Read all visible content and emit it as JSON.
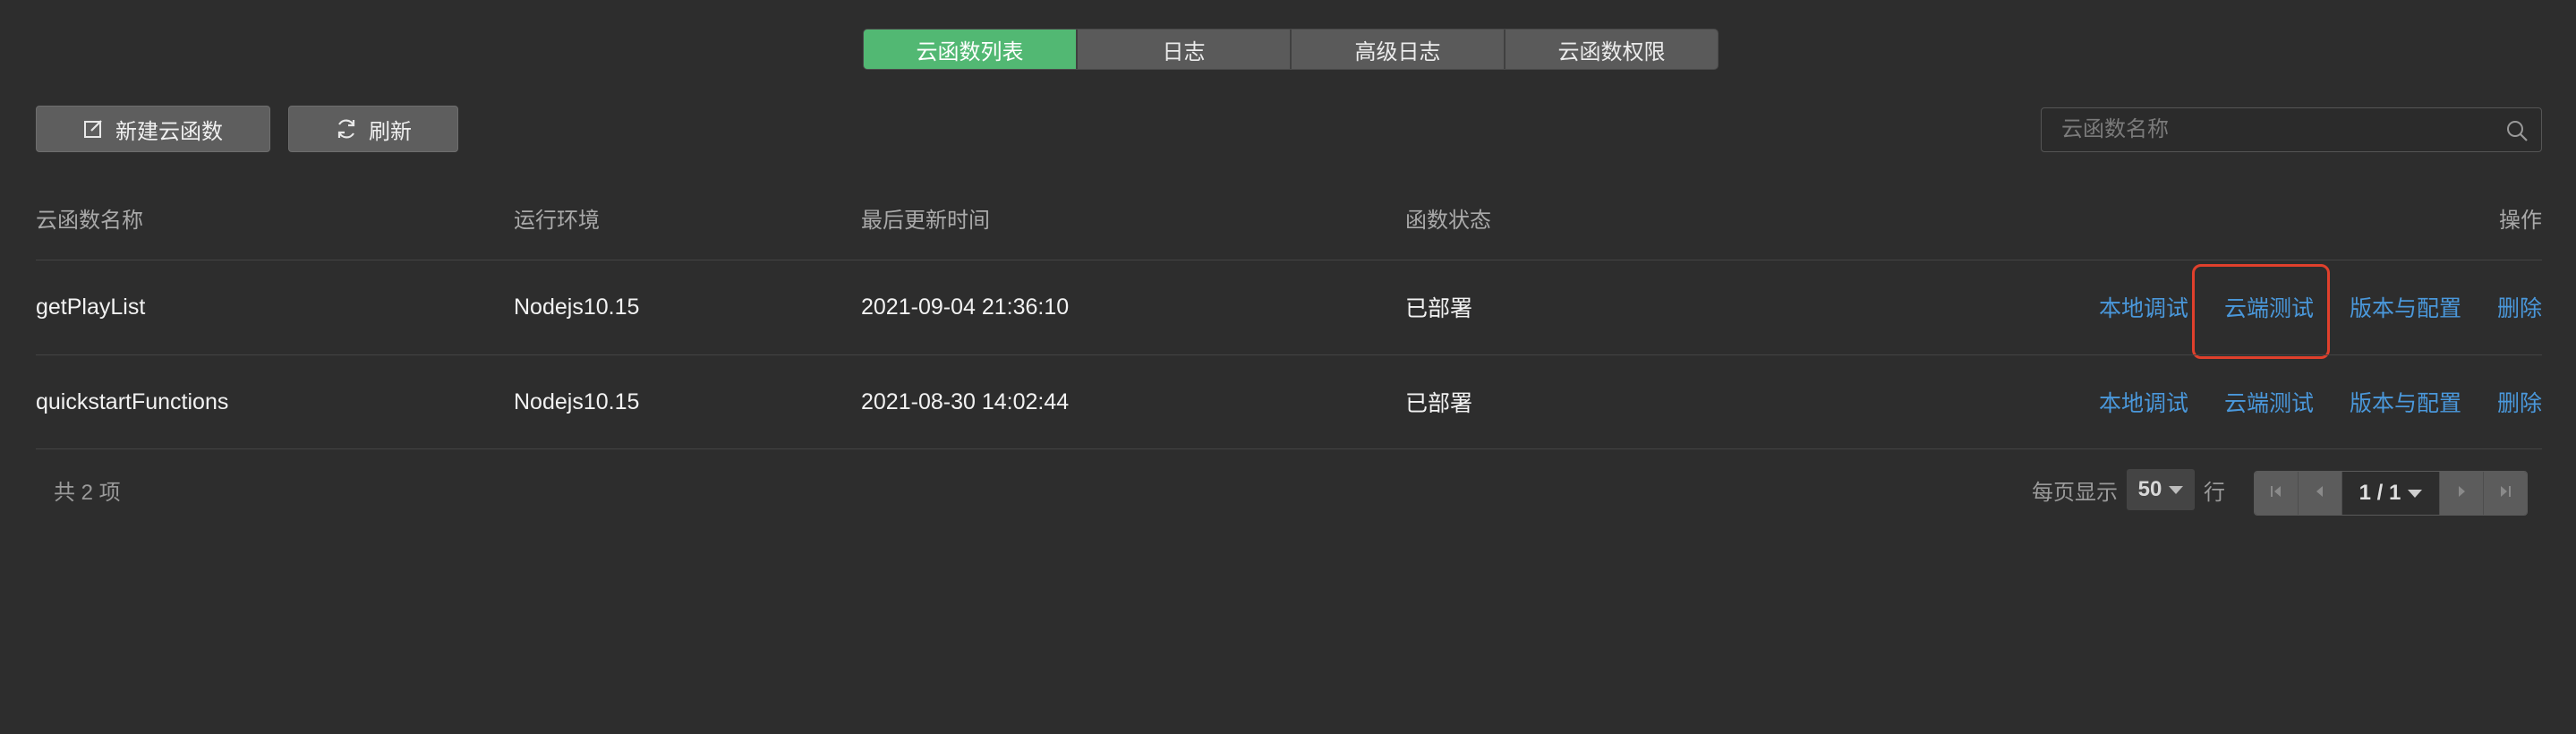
{
  "tabs": [
    "云函数列表",
    "日志",
    "高级日志",
    "云函数权限"
  ],
  "active_tab": 0,
  "toolbar": {
    "new_label": "新建云函数",
    "refresh_label": "刷新"
  },
  "search": {
    "placeholder": "云函数名称",
    "value": ""
  },
  "table": {
    "headers": {
      "name": "云函数名称",
      "env": "运行环境",
      "time": "最后更新时间",
      "status": "函数状态",
      "actions": "操作"
    },
    "rows": [
      {
        "name": "getPlayList",
        "env": "Nodejs10.15",
        "time": "2021-09-04 21:36:10",
        "status": "已部署",
        "actions": [
          "本地调试",
          "云端测试",
          "版本与配置",
          "删除"
        ]
      },
      {
        "name": "quickstartFunctions",
        "env": "Nodejs10.15",
        "time": "2021-08-30 14:02:44",
        "status": "已部署",
        "actions": [
          "本地调试",
          "云端测试",
          "版本与配置",
          "删除"
        ]
      }
    ]
  },
  "footer": {
    "total": "共 2 项",
    "per_page_prefix": "每页显示",
    "per_page_value": "50",
    "per_page_suffix": "行",
    "page_info": "1 / 1"
  },
  "colors": {
    "active_tab": "#52b873",
    "link": "#4a98db",
    "highlight": "#e0402c",
    "background": "#2d2d2d"
  },
  "icons": [
    "edit-icon",
    "refresh-icon",
    "search-icon",
    "first-page-icon",
    "prev-page-icon",
    "next-page-icon",
    "last-page-icon"
  ]
}
